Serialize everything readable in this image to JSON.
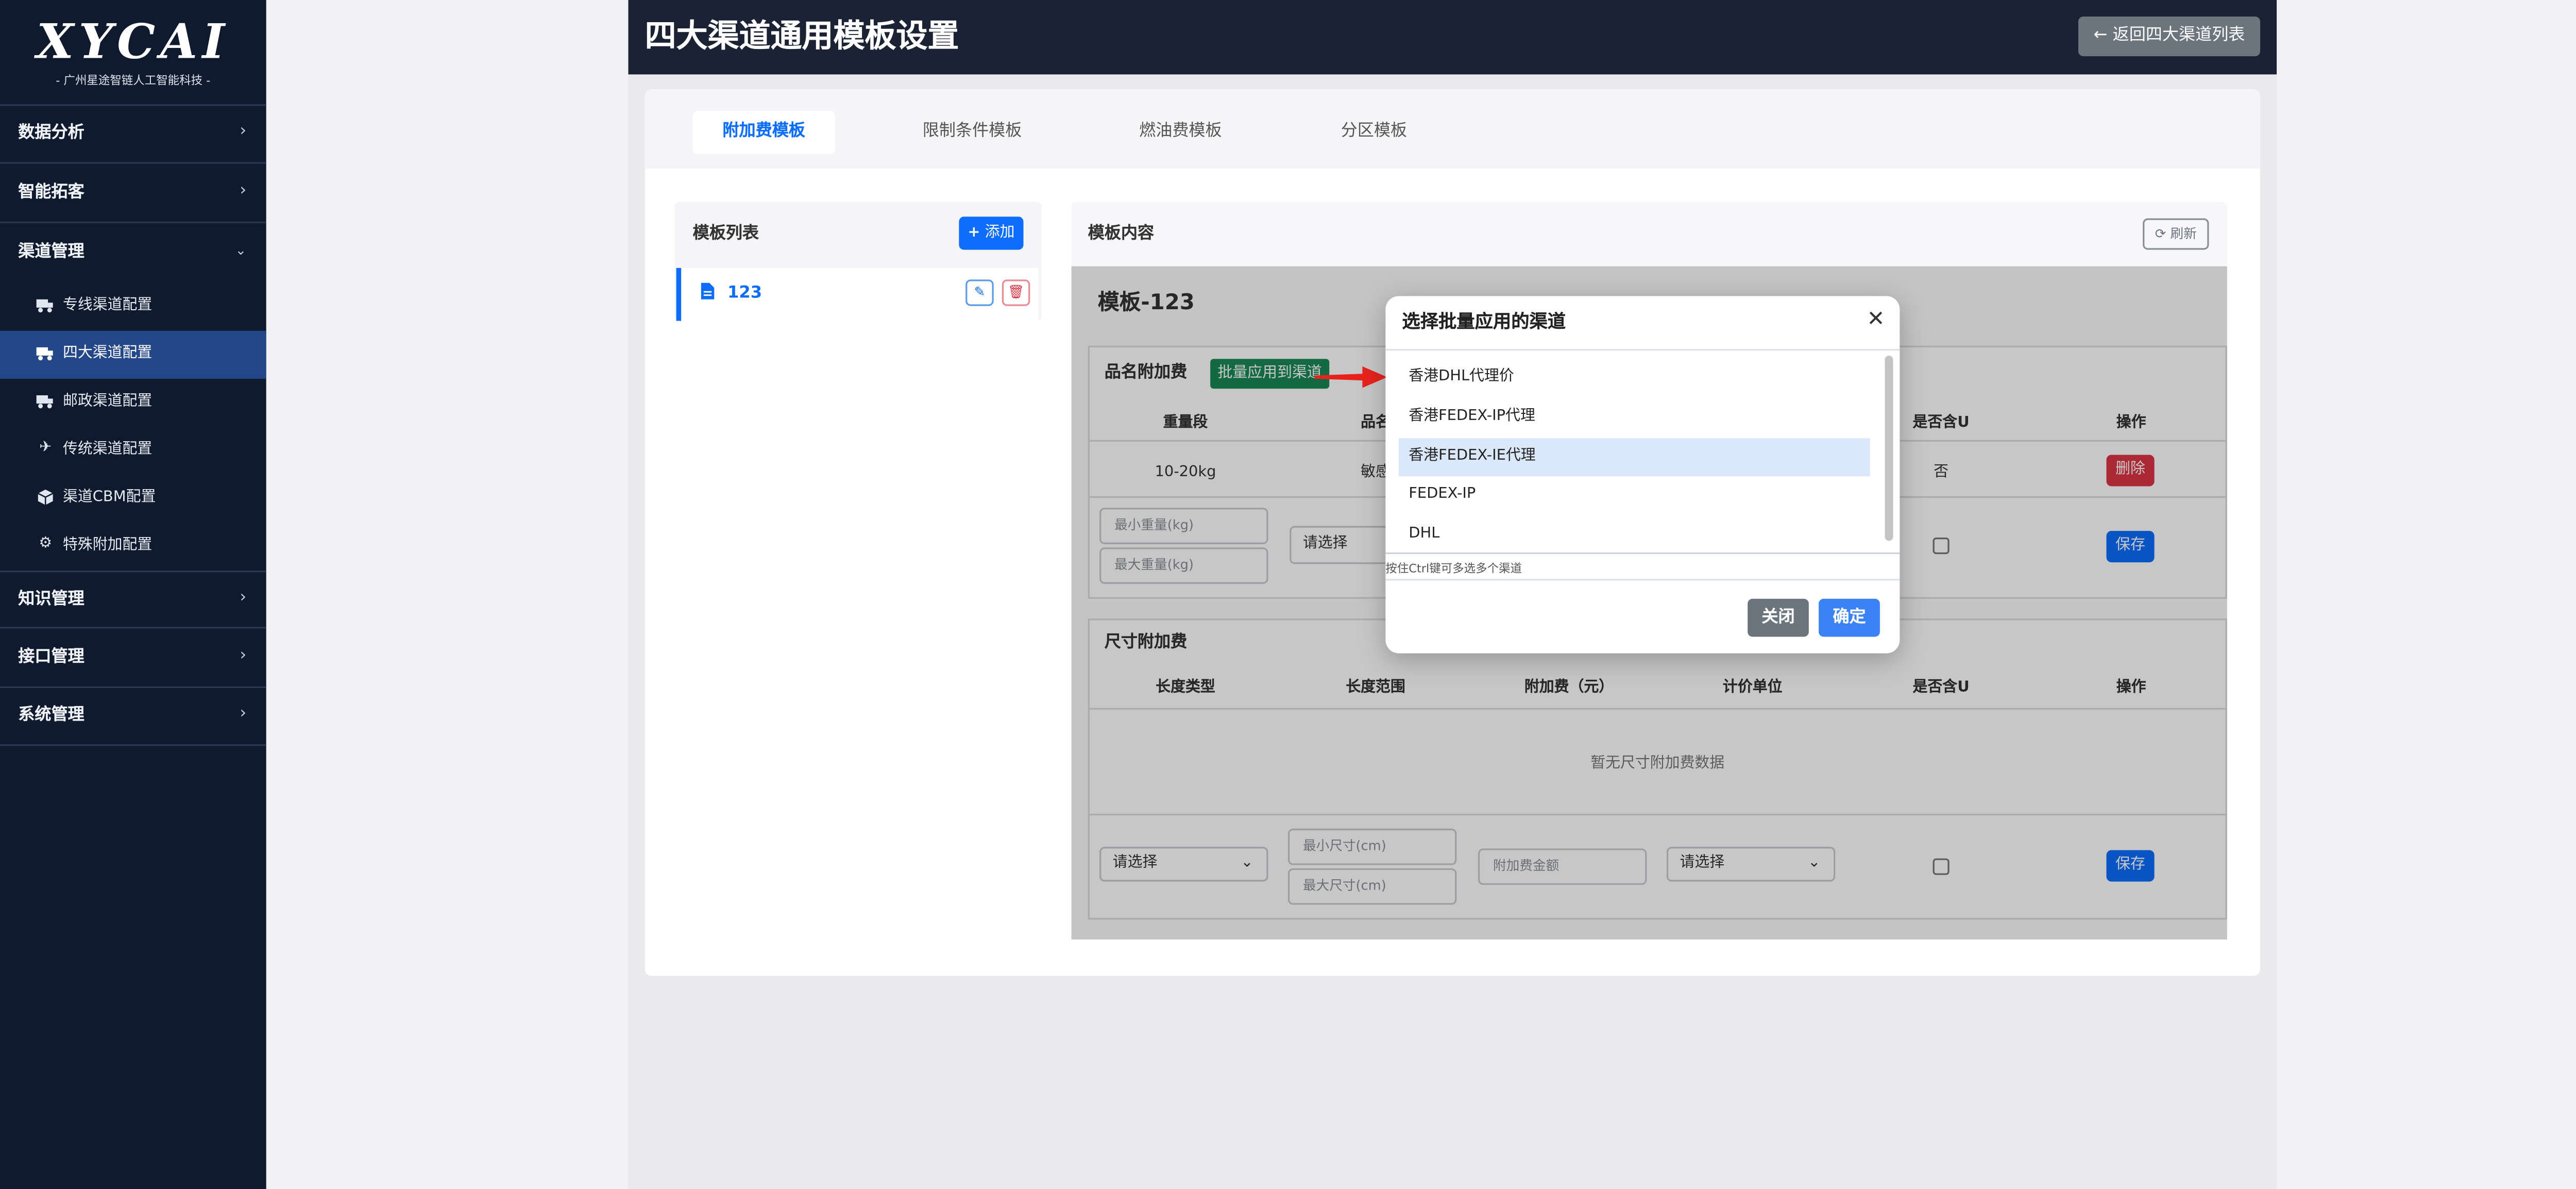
{
  "sidebar": {
    "logo": {
      "main": "XYCAI",
      "sub": "- 广州星途智链人工智能科技 -"
    },
    "nav": [
      {
        "label": "数据分析",
        "icon": "chevron-right-icon"
      },
      {
        "label": "智能拓客",
        "icon": "chevron-right-icon"
      },
      {
        "label": "渠道管理",
        "icon": "chevron-down-icon"
      },
      {
        "label": "知识管理",
        "icon": "chevron-right-icon"
      },
      {
        "label": "接口管理",
        "icon": "chevron-right-icon"
      },
      {
        "label": "系统管理",
        "icon": "chevron-right-icon"
      }
    ],
    "sub_items": [
      {
        "label": "专线渠道配置",
        "icon": "truck-icon"
      },
      {
        "label": "四大渠道配置",
        "icon": "truck-fast-icon",
        "active": true
      },
      {
        "label": "邮政渠道配置",
        "icon": "truck-icon"
      },
      {
        "label": "传统渠道配置",
        "icon": "plane-icon"
      },
      {
        "label": "渠道CBM配置",
        "icon": "box-icon"
      },
      {
        "label": "特殊附加配置",
        "icon": "gear-icon"
      }
    ]
  },
  "header": {
    "title": "四大渠道通用模板设置",
    "back_label": "返回四大渠道列表"
  },
  "tabs": [
    {
      "label": "附加费模板",
      "active": true
    },
    {
      "label": "限制条件模板"
    },
    {
      "label": "燃油费模板"
    },
    {
      "label": "分区模板"
    }
  ],
  "template_list": {
    "title": "模板列表",
    "add_label": "添加",
    "items": [
      {
        "name": "123"
      }
    ]
  },
  "template_content": {
    "title": "模板内容",
    "refresh_label": "刷新",
    "template_name": "模板-123",
    "product_section": {
      "title": "品名附加费",
      "apply_button": "批量应用到渠道",
      "headers": [
        "重量段",
        "品名",
        "是否含U",
        "操作"
      ],
      "row": {
        "weight": "10-20kg",
        "name": "敏感",
        "include_u": "否",
        "delete": "删除"
      },
      "min_weight_placeholder": "最小重量(kg)",
      "max_weight_placeholder": "最大重量(kg)",
      "select_placeholder": "请选择",
      "save_label": "保存"
    },
    "size_section": {
      "title": "尺寸附加费",
      "headers": [
        "长度类型",
        "长度范围",
        "附加费（元）",
        "计价单位",
        "是否含U",
        "操作"
      ],
      "empty": "暂无尺寸附加费数据",
      "length_type_select": "请选择",
      "min_size_placeholder": "最小尺寸(cm)",
      "max_size_placeholder": "最大尺寸(cm)",
      "fee_placeholder": "附加费金额",
      "unit_select": "请选择",
      "save_label": "保存"
    }
  },
  "modal": {
    "title": "选择批量应用的渠道",
    "options": [
      {
        "label": "香港DHL代理价"
      },
      {
        "label": "香港FEDEX-IP代理"
      },
      {
        "label": "香港FEDEX-IE代理",
        "selected": true
      },
      {
        "label": "FEDEX-IP"
      },
      {
        "label": "DHL"
      }
    ],
    "hint": "按住Ctrl键可多选多个渠道",
    "close_label": "关闭",
    "confirm_label": "确定"
  },
  "colors": {
    "sidebar_bg": "#0f1a2e",
    "sidebar_active": "#24478a",
    "header_bg": "#1a2233",
    "primary": "#0d6efd",
    "success": "#198754",
    "danger": "#dc3545",
    "secondary": "#6c757d",
    "annotation_arrow": "#e8231d"
  }
}
